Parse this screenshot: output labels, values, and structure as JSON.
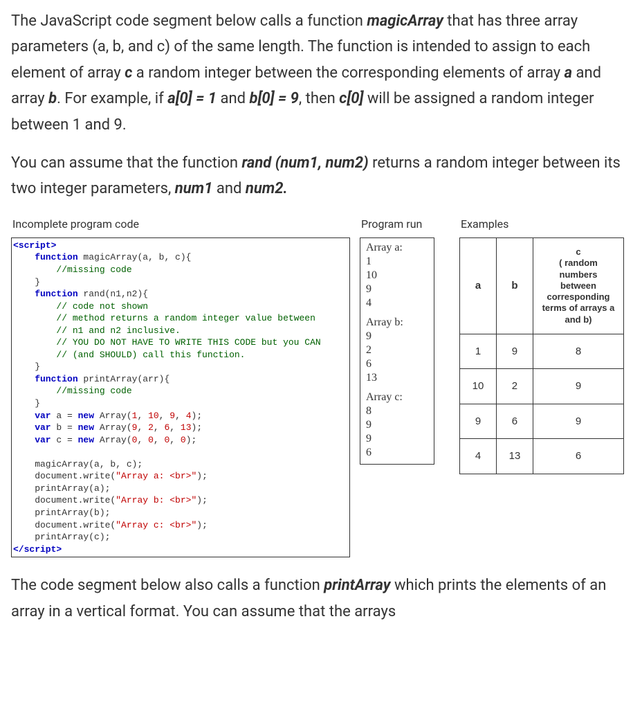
{
  "intro": {
    "p1_a": "The JavaScript code segment below calls a function ",
    "p1_fn": "magicArray",
    "p1_b": " that has three array parameters (a, b, and c) of the same length. The function is intended to assign to each element of array ",
    "p1_c": "c",
    "p1_d": " a random integer between the corresponding elements of array ",
    "p1_a2": "a",
    "p1_e": " and array ",
    "p1_b2": "b",
    "p1_f": ". For example, if ",
    "p1_a0": "a[0] = 1",
    "p1_g": " and ",
    "p1_b0": "b[0] = 9",
    "p1_h": ", then ",
    "p1_c0": "c[0]",
    "p1_i": " will be assigned a random integer between 1 and 9.",
    "p2_a": "You can assume that the function ",
    "p2_rand": "rand (num1, num2) ",
    "p2_b": "returns a random integer between its two integer parameters, ",
    "p2_n1": "num1",
    "p2_c": " and ",
    "p2_n2": "num2."
  },
  "headers": {
    "code": "Incomplete program code",
    "run": "Program run",
    "ex": "Examples"
  },
  "code": {
    "l01": "<script>",
    "l02a": "    function",
    "l02b": " magicArray(a, b, c){",
    "l03a": "        ",
    "l03b": "//missing code",
    "l04": "    }",
    "l05a": "    function",
    "l05b": " rand(n1,n2){",
    "l06a": "        ",
    "l06b": "// code not shown",
    "l07a": "        ",
    "l07b": "// method returns a random integer value between",
    "l08a": "        ",
    "l08b": "// n1 and n2 inclusive.",
    "l09a": "        ",
    "l09b": "// YOU DO NOT HAVE TO WRITE THIS CODE but you CAN",
    "l10a": "        ",
    "l10b": "// (and SHOULD) call this function.",
    "l11": "    }",
    "l12a": "    function",
    "l12b": " printArray(arr){",
    "l13a": "        ",
    "l13b": "//missing code",
    "l14": "    }",
    "l15a": "    var",
    "l15b": " a = ",
    "l15c": "new",
    "l15d": " Array(",
    "l15e": "1",
    "l15f": ", ",
    "l15g": "10",
    "l15h": ", ",
    "l15i": "9",
    "l15j": ", ",
    "l15k": "4",
    "l15l": ");",
    "l16a": "    var",
    "l16b": " b = ",
    "l16c": "new",
    "l16d": " Array(",
    "l16e": "9",
    "l16f": ", ",
    "l16g": "2",
    "l16h": ", ",
    "l16i": "6",
    "l16j": ", ",
    "l16k": "13",
    "l16l": ");",
    "l17a": "    var",
    "l17b": " c = ",
    "l17c": "new",
    "l17d": " Array(",
    "l17e": "0",
    "l17f": ", ",
    "l17g": "0",
    "l17h": ", ",
    "l17i": "0",
    "l17j": ", ",
    "l17k": "0",
    "l17l": ");",
    "l18": "",
    "l19": "    magicArray(a, b, c);",
    "l20a": "    document.write(",
    "l20b": "\"Array a: <br>\"",
    "l20c": ");",
    "l21": "    printArray(a);",
    "l22a": "    document.write(",
    "l22b": "\"Array b: <br>\"",
    "l22c": ");",
    "l23": "    printArray(b);",
    "l24a": "    document.write(",
    "l24b": "\"Array c: <br>\"",
    "l24c": ");",
    "l25": "    printArray(c);",
    "l26": "</script>"
  },
  "run": {
    "h1": "Array a:",
    "a1": "1",
    "a2": "10",
    "a3": "9",
    "a4": "4",
    "h2": "Array b:",
    "b1": "9",
    "b2": "2",
    "b3": "6",
    "b4": "13",
    "h3": "Array c:",
    "c1": "8",
    "c2": "9",
    "c3": "9",
    "c4": "6"
  },
  "examples": {
    "head_a": "a",
    "head_b": "b",
    "head_c1": "c",
    "head_c2": "( random numbers between corresponding terms of arrays a and b)",
    "rows": [
      {
        "a": "1",
        "b": "9",
        "c": "8"
      },
      {
        "a": "10",
        "b": "2",
        "c": "9"
      },
      {
        "a": "9",
        "b": "6",
        "c": "9"
      },
      {
        "a": "4",
        "b": "13",
        "c": "6"
      }
    ]
  },
  "footer": {
    "a": "The code segment below also calls a function ",
    "fn": "printArray",
    "b": " which prints the elements of an array in a vertical format. You can assume that the arrays"
  }
}
